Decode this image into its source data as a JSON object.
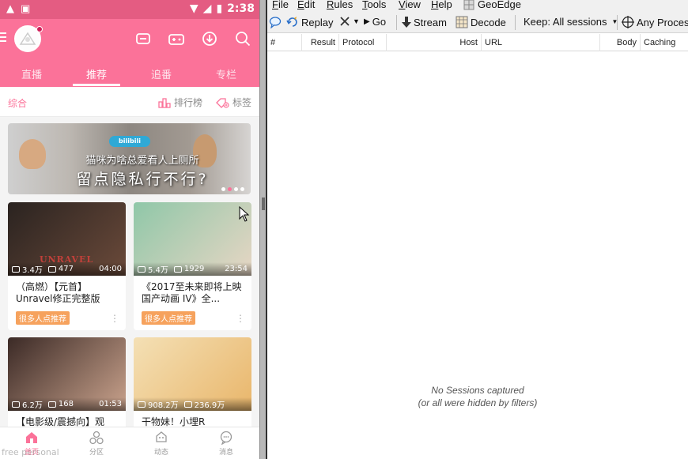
{
  "phone": {
    "status": {
      "time": "2:38"
    },
    "tabs": [
      {
        "label": "直播"
      },
      {
        "label": "推荐"
      },
      {
        "label": "追番"
      },
      {
        "label": "专栏"
      }
    ],
    "subbar": {
      "left": "综合",
      "rank": "排行榜",
      "tags": "标签"
    },
    "banner": {
      "logo": "bilibili",
      "line1": "猫咪为啥总爱看人上厕所",
      "line2": "留点隐私行不行?"
    },
    "cards": [
      {
        "views": "3.4万",
        "danmaku": "477",
        "duration": "04:00",
        "title": "（高燃）【元首】Unravel修正完整版",
        "badge": "很多人点推荐",
        "thumb_text": "UNRAVEL",
        "colors": [
          "#2a2320",
          "#6b4a3a"
        ]
      },
      {
        "views": "5.4万",
        "danmaku": "1929",
        "duration": "23:54",
        "title": "《2017至未来即将上映国产动画 IV》全...",
        "badge": "很多人点推荐",
        "thumb_text": "",
        "colors": [
          "#8fc7a8",
          "#e7d6c4"
        ]
      },
      {
        "views": "6.2万",
        "danmaku": "168",
        "duration": "01:53",
        "title": "【电影级/震撼向】观",
        "badge": "",
        "thumb_text": "",
        "colors": [
          "#3b2a26",
          "#c9a28c"
        ]
      },
      {
        "views": "908.2万",
        "danmaku": "236.9万",
        "duration": "",
        "title": "干物妹！小埋R",
        "badge": "",
        "thumb_text": "",
        "colors": [
          "#f4e0b5",
          "#e9b66b"
        ]
      }
    ],
    "bottom_nav": [
      {
        "label": "首页"
      },
      {
        "label": "分区"
      },
      {
        "label": "动态"
      },
      {
        "label": "消息"
      }
    ],
    "watermark": "free personal",
    "accent": "#fb7299"
  },
  "fiddler": {
    "menu": [
      {
        "label": "File",
        "u": "F",
        "rest": "ile"
      },
      {
        "label": "Edit",
        "u": "E",
        "rest": "dit"
      },
      {
        "label": "Rules",
        "u": "R",
        "rest": "ules"
      },
      {
        "label": "Tools",
        "u": "T",
        "rest": "ools"
      },
      {
        "label": "View",
        "u": "V",
        "rest": "iew"
      },
      {
        "label": "Help",
        "u": "H",
        "rest": "elp"
      }
    ],
    "geoedge": "GeoEdge",
    "toolbar": {
      "replay": "Replay",
      "go": "Go",
      "stream": "Stream",
      "decode": "Decode",
      "keep": "Keep: All sessions",
      "any_process": "Any Proces"
    },
    "columns": [
      "#",
      "Result",
      "Protocol",
      "Host",
      "URL",
      "Body",
      "Caching"
    ],
    "empty": {
      "line1": "No Sessions captured",
      "line2": "(or all were hidden by filters)"
    }
  }
}
